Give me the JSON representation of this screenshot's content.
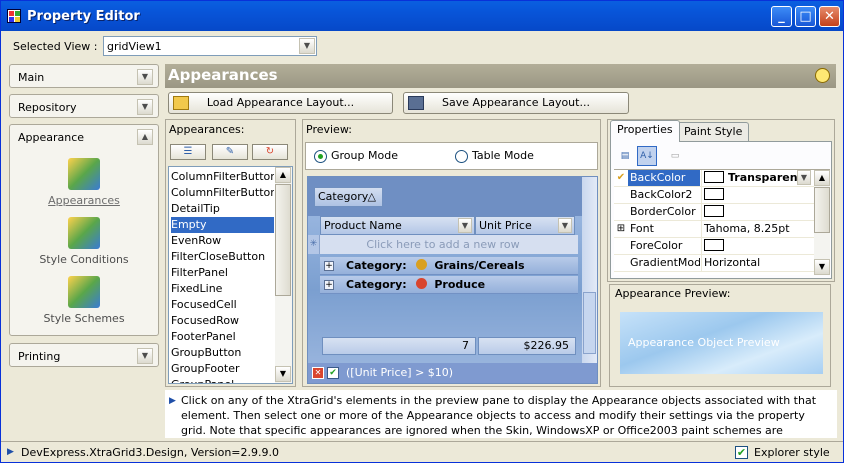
{
  "window": {
    "title": "Property Editor"
  },
  "selected_view": {
    "label": "Selected View :",
    "value": "gridView1"
  },
  "nav": {
    "main": "Main",
    "repository": "Repository",
    "appearance": "Appearance",
    "printing": "Printing",
    "appearance_items": [
      "Appearances",
      "Style Conditions",
      "Style Schemes"
    ]
  },
  "header": {
    "title": "Appearances"
  },
  "buttons": {
    "load": "Load Appearance Layout...",
    "save": "Save Appearance Layout..."
  },
  "appearances_list": {
    "caption": "Appearances:",
    "items": [
      "ColumnFilterButton",
      "ColumnFilterButtonActive",
      "DetailTip",
      "Empty",
      "EvenRow",
      "FilterCloseButton",
      "FilterPanel",
      "FixedLine",
      "FocusedCell",
      "FocusedRow",
      "FooterPanel",
      "GroupButton",
      "GroupFooter",
      "GroupPanel"
    ],
    "selected": "Empty"
  },
  "preview": {
    "caption": "Preview:",
    "group_mode": "Group Mode",
    "table_mode": "Table Mode",
    "mode_selected": "Group Mode",
    "group_column": "Category",
    "columns": [
      "Product Name",
      "Unit Price"
    ],
    "new_row_text": "Click here to add a new row",
    "groups": [
      {
        "label": "Category:",
        "value": "Grains/Cereals"
      },
      {
        "label": "Category:",
        "value": "Produce"
      }
    ],
    "footer": {
      "count": "7",
      "sum": "$226.95"
    },
    "filter": "([Unit Price] > $10)"
  },
  "property_grid": {
    "tabs": [
      "Properties",
      "Paint Style"
    ],
    "active_tab": "Properties",
    "rows": [
      {
        "name": "BackColor",
        "value": "Transparent",
        "swatch": true
      },
      {
        "name": "BackColor2",
        "value": "",
        "swatch": true
      },
      {
        "name": "BorderColor",
        "value": "",
        "swatch": true
      },
      {
        "name": "Font",
        "value": "Tahoma, 8.25pt",
        "swatch": false
      },
      {
        "name": "ForeColor",
        "value": "",
        "swatch": true
      },
      {
        "name": "GradientMode",
        "value": "Horizontal",
        "swatch": false
      }
    ]
  },
  "appearance_preview": {
    "caption": "Appearance Preview:",
    "text": "Appearance Object Preview"
  },
  "hint": "Click on any of the XtraGrid's elements in the preview pane to display the Appearance objects associated with that element. Then select one or more of the Appearance objects to access and modify their settings via the property grid. Note that specific appearances are ignored when the Skin, WindowsXP or Office2003 paint schemes are applied.",
  "status": {
    "text": "DevExpress.XtraGrid3.Design, Version=2.9.9.0",
    "explorer_style": "Explorer style"
  },
  "colors": {
    "titlebar": "#0854d8",
    "selection": "#316ac5",
    "header": "#9b9784"
  }
}
